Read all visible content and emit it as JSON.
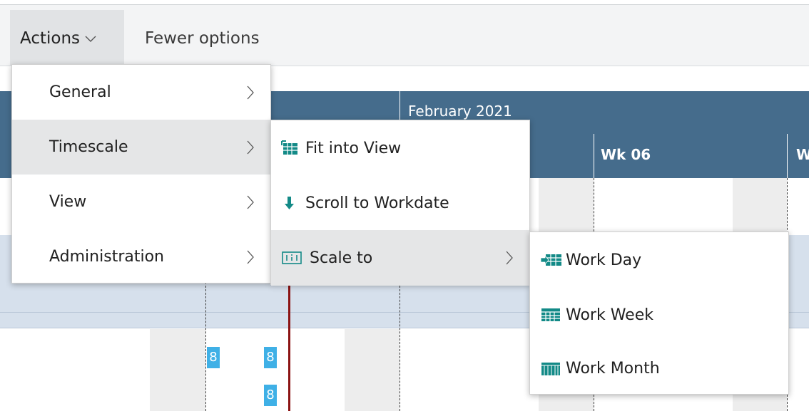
{
  "toolbar": {
    "actions_label": "Actions",
    "fewer_label": "Fewer options"
  },
  "gantt": {
    "month_label": "February 2021",
    "week_label": "Wk 06",
    "next_week_label": "W",
    "tasks": [
      {
        "value": "8"
      },
      {
        "value": "8"
      },
      {
        "value": "8"
      }
    ]
  },
  "menus": {
    "main": {
      "items": [
        {
          "label": "General"
        },
        {
          "label": "Timescale"
        },
        {
          "label": "View"
        },
        {
          "label": "Administration"
        }
      ],
      "highlighted": "Timescale"
    },
    "timescale": {
      "items": [
        {
          "label": "Fit into View",
          "icon": "fit-into-view-icon"
        },
        {
          "label": "Scroll to Workdate",
          "icon": "scroll-down-arrow-icon"
        },
        {
          "label": "Scale to",
          "icon": "scale-to-icon"
        }
      ],
      "highlighted": "Scale to"
    },
    "scale_to": {
      "items": [
        {
          "label": "Work Day",
          "icon": "work-day-icon"
        },
        {
          "label": "Work Week",
          "icon": "work-week-icon"
        },
        {
          "label": "Work Month",
          "icon": "work-month-icon"
        }
      ]
    }
  },
  "colors": {
    "header_blue": "#456c8c",
    "today_line": "#8b1313",
    "task_blue": "#3fb0e6",
    "icon_teal": "#138a87"
  }
}
